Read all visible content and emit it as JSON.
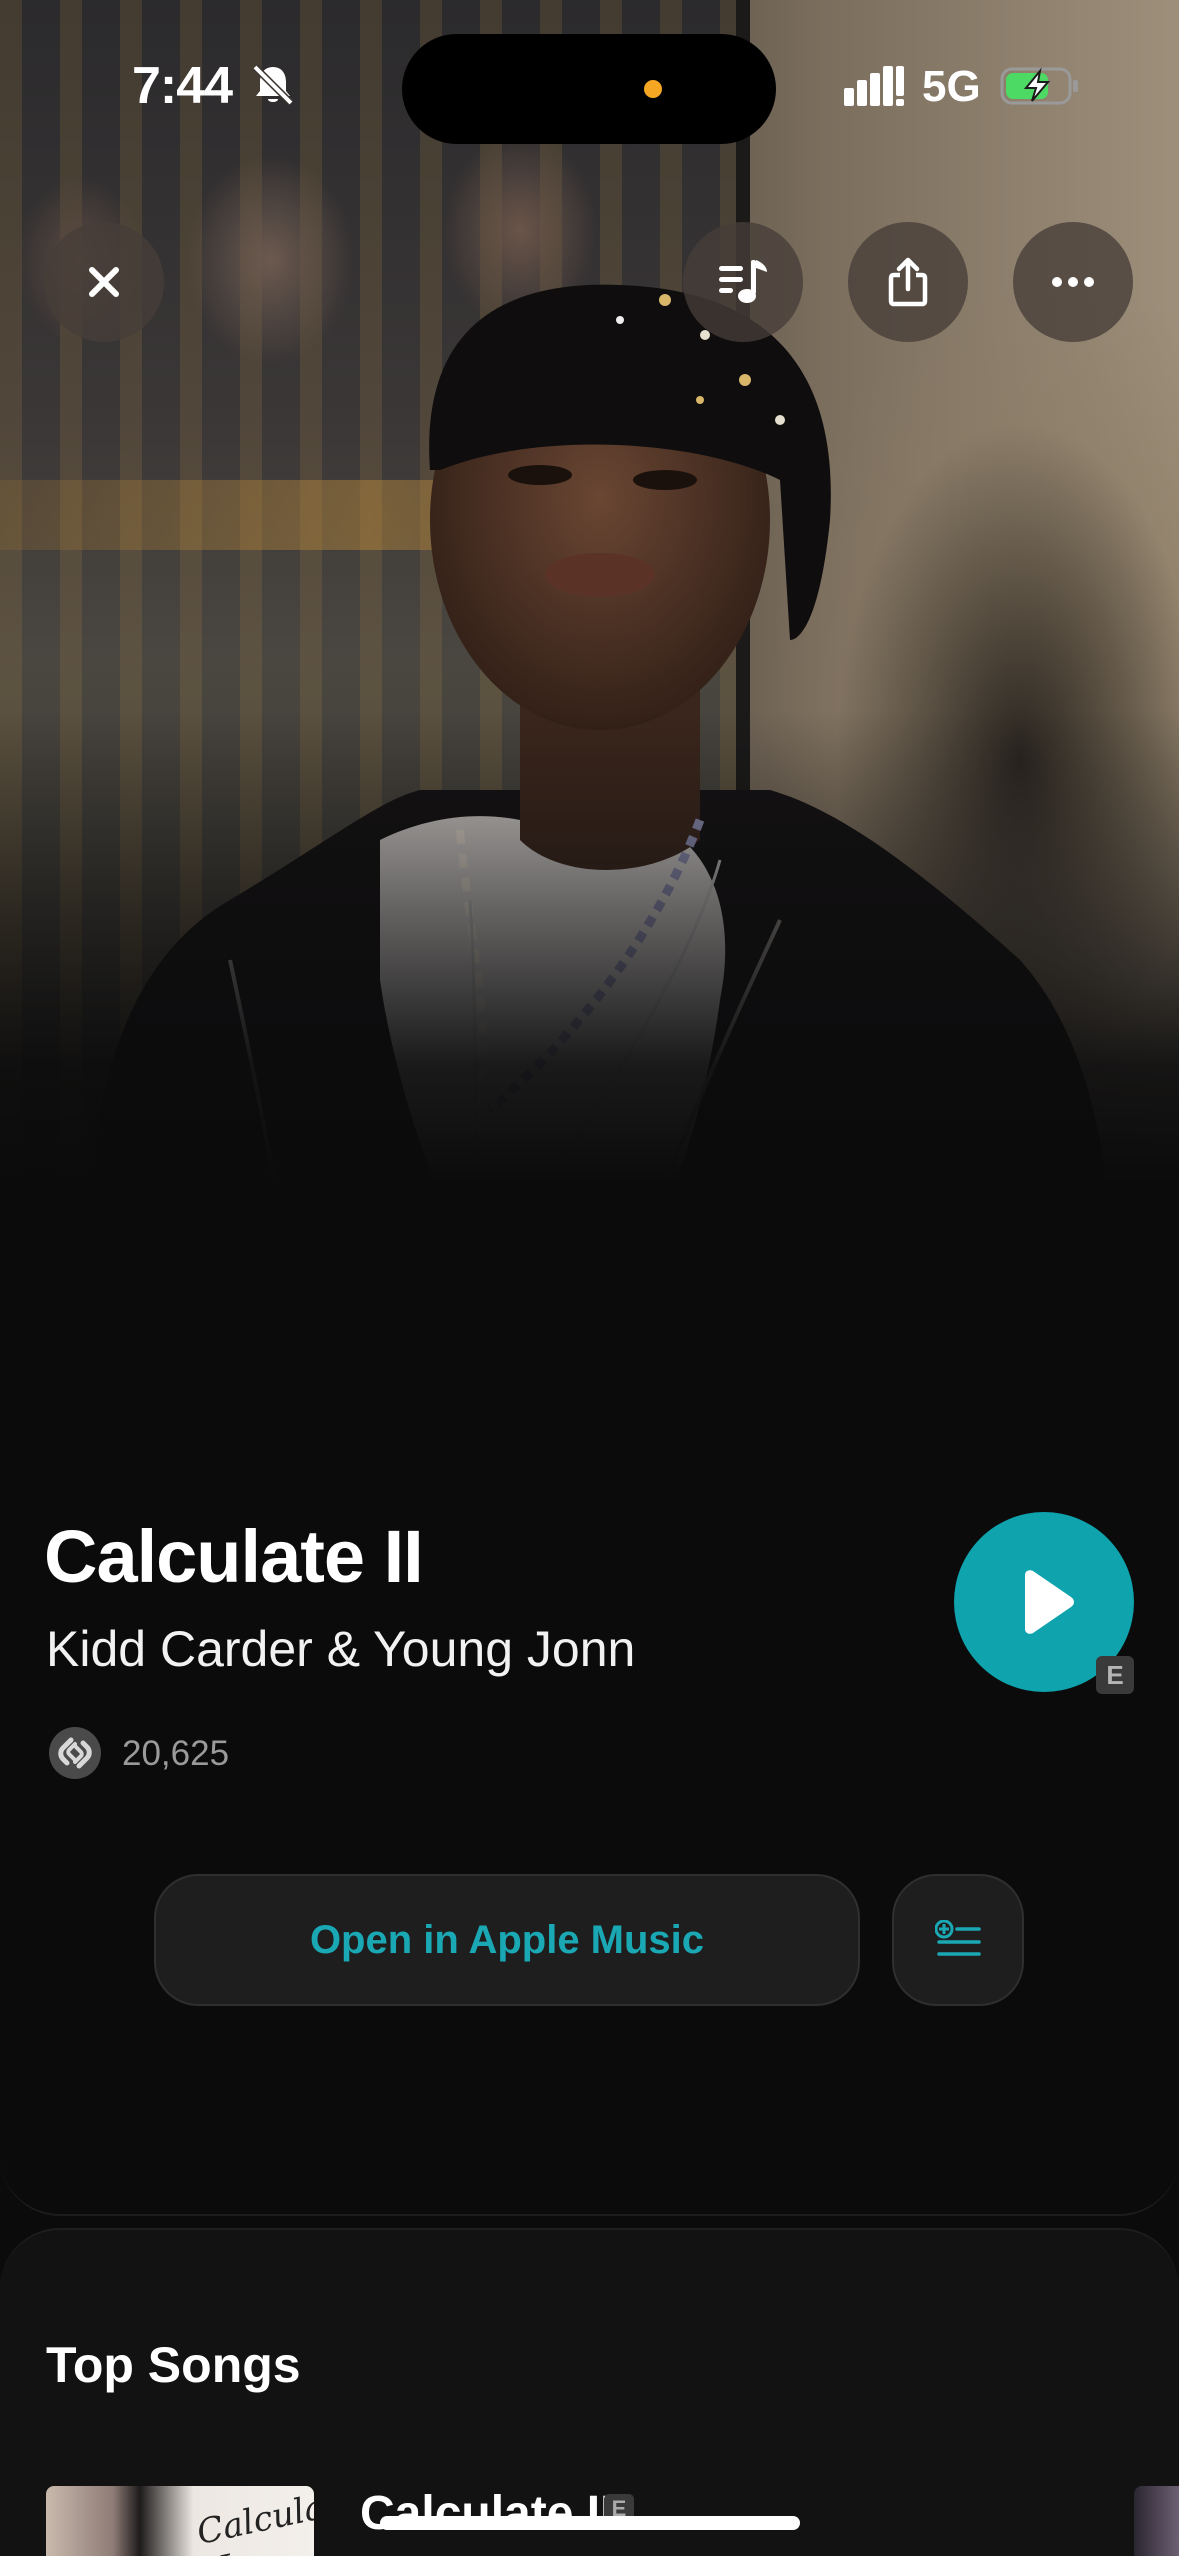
{
  "status_bar": {
    "time": "7:44",
    "network": "5G",
    "icons": [
      "bell-slash-icon",
      "signal-icon",
      "battery-charging-icon"
    ],
    "battery_color": "#4cd964",
    "recording_dot_color": "#f5a623"
  },
  "top_actions": {
    "close_icon": "close-icon",
    "actions": [
      "playlist-music-icon",
      "share-icon",
      "more-icon"
    ]
  },
  "track": {
    "title": "Calculate II",
    "artist": "Kidd Carder & Young Jonn",
    "shazam_count": "20,625",
    "explicit_badge": "E"
  },
  "buttons": {
    "open_label": "Open in Apple Music",
    "accent_color": "#0fa3ad"
  },
  "top_songs": {
    "heading": "Top Songs",
    "items": [
      {
        "title": "Calculate II",
        "explicit": "E",
        "art_text": "Calculate II"
      }
    ]
  }
}
